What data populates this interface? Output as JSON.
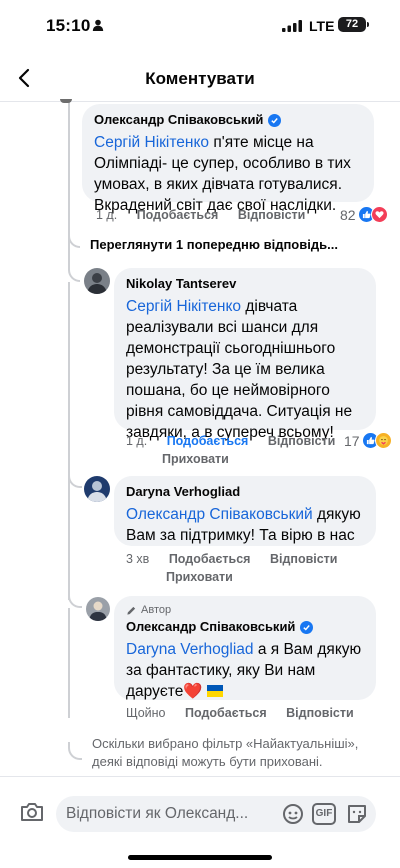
{
  "status_bar": {
    "time": "15:10",
    "network": "LTE",
    "battery": "72"
  },
  "header": {
    "title": "Коментувати"
  },
  "comments": [
    {
      "author": "Олександр Співаковський",
      "verified": true,
      "mention": "Сергій Нікітенко",
      "text": " п'яте місце на Олімпіаді- це супер, особливо в тих умовах, в яких дівчата готувалися. Вкрадений світ дає свої наслідки.",
      "time": "1 д.",
      "like": "Подобається",
      "reply": "Відповісти",
      "reactions_count": "82"
    },
    {
      "author": "Nikolay Tantserev",
      "mention": "Сергій Нікітенко",
      "text": " дівчата реалізували всі шанси для демонстрації сьогоднішнього результату! За це їм велика пошана, бо це неймовірного рівня самовіддача. Ситуація не завдяки, а в супереч всьому!",
      "time": "1 д.",
      "like": "Подобається",
      "reply": "Відповісти",
      "hide": "Приховати",
      "reactions_count": "17"
    },
    {
      "author": "Daryna Verhogliad",
      "mention": "Олександр Співаковський",
      "text": " дякую Вам за підтримку! Та вірю в нас",
      "time": "3 хв",
      "like": "Подобається",
      "reply": "Відповісти",
      "hide": "Приховати"
    },
    {
      "badge": "Автор",
      "author": "Олександр Співаковський",
      "verified": true,
      "mention": "Daryna Verhogliad",
      "text": " а я Вам дякую за фантастику, яку Ви нам даруєте",
      "emoji": "❤️",
      "time": "Щойно",
      "like": "Подобається",
      "reply": "Відповісти"
    }
  ],
  "see_previous": "Переглянути 1 попередню відповідь...",
  "footnote": "Оскільки вибрано фільтр «Найактуальніші», деякі відповіді можуть бути приховані.",
  "composer": {
    "placeholder": "Відповісти як Олександ..."
  },
  "colors": {
    "accent": "#1877f2",
    "mention": "#1866d9",
    "bubble": "#f0f2f5",
    "meta": "#65676b"
  }
}
